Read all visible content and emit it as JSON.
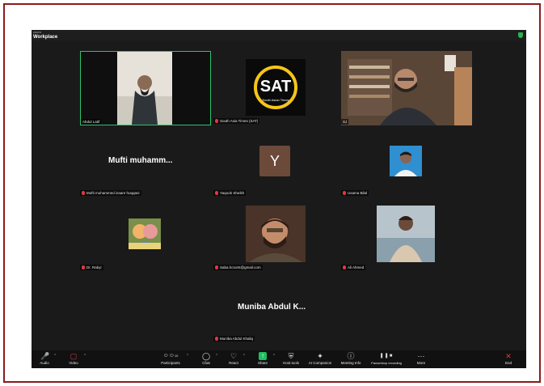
{
  "window": {
    "app_small": "zoom",
    "app_title": "Workplace"
  },
  "tiles": {
    "abdul": {
      "name": "Abdul Latif"
    },
    "sat": {
      "name": "South Asia Times (SAT)",
      "logo_text": "SAT",
      "logo_sub": "South Asian Times"
    },
    "sj": {
      "name": "SJ"
    },
    "mufti": {
      "name": "Mufti muhammed izaare hoqqani",
      "display": "Mufti muhamm..."
    },
    "yaqoob": {
      "name": "Yaqoob Sheikh",
      "avatar_letter": "Y"
    },
    "usama": {
      "name": "Usama Bilal"
    },
    "rabyi": {
      "name": "Dr. Rabyi"
    },
    "email": {
      "name": "Saba.hcrumt@gmail.com"
    },
    "ali": {
      "name": "Ali Ahmed"
    },
    "muniba": {
      "name": "Muniba Abdul Khaliq",
      "display": "Muniba Abdul K..."
    }
  },
  "toolbar": {
    "audio": "Audio",
    "video": "Video",
    "participants": "Participants",
    "participants_count": "10",
    "chat": "Chat",
    "react": "React",
    "share": "Share",
    "host_tools": "Host tools",
    "ai_companion": "AI Companion",
    "meeting_info": "Meeting Info",
    "recording": "Pause/stop recording",
    "more": "More",
    "end": "End"
  },
  "colors": {
    "frame_border": "#8b1a1a",
    "active_speaker": "#2cc36b",
    "mic_muted": "#e0383e",
    "share_green": "#1fbf5f",
    "end_red": "#e0383e"
  }
}
